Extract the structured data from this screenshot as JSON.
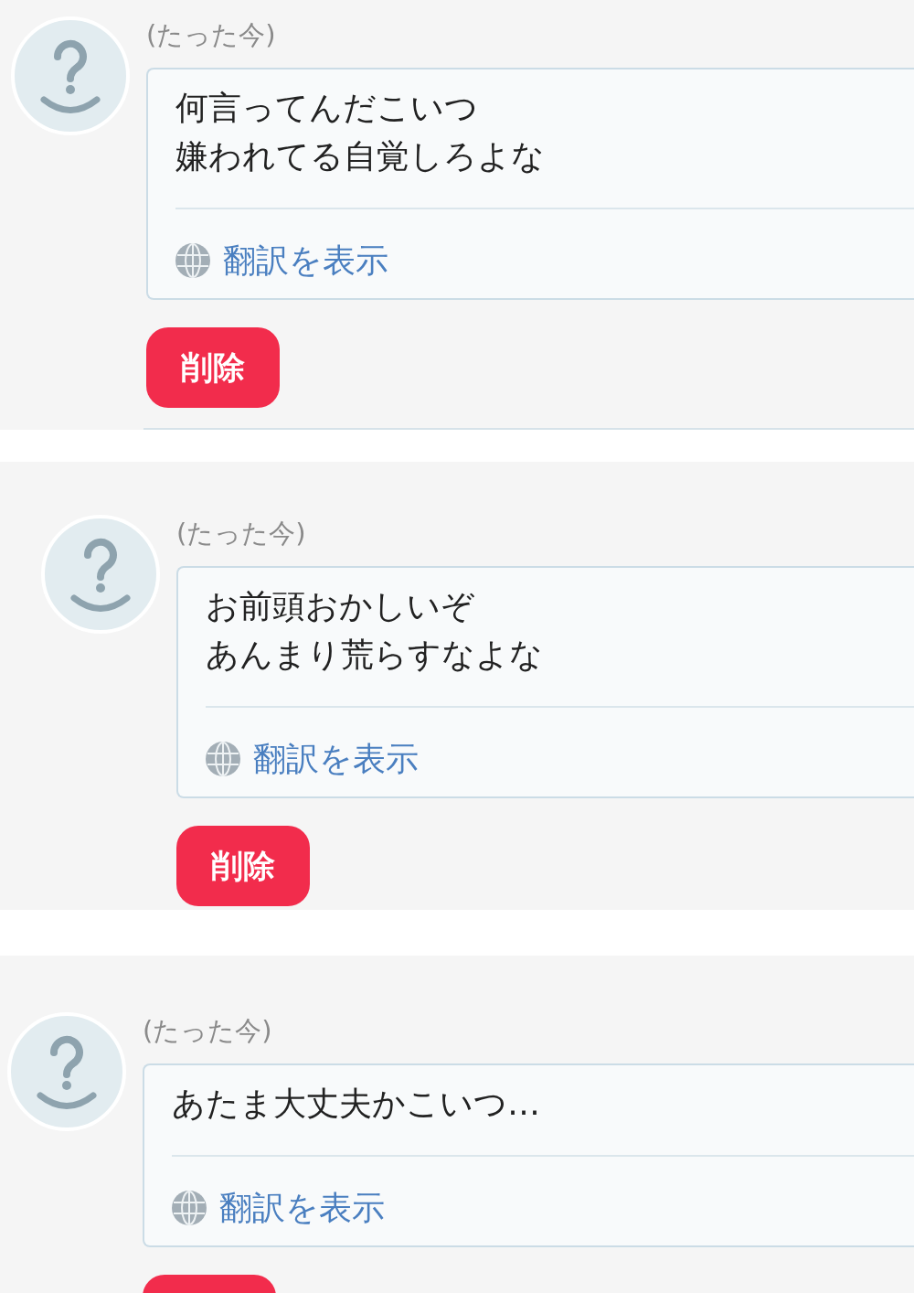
{
  "comments": [
    {
      "timestamp": "(たった今)",
      "message_lines": [
        "何言ってんだこいつ",
        "嫌われてる自覚しろよな"
      ],
      "translate_link": "翻訳を表示",
      "actions": [
        {
          "kind": "delete",
          "label": "削除"
        }
      ]
    },
    {
      "timestamp": "(たった今)",
      "message_lines": [
        "お前頭おかしいぞ",
        "あんまり荒らすなよな"
      ],
      "translate_link": "翻訳を表示",
      "actions": [
        {
          "kind": "delete",
          "label": "削除"
        }
      ]
    },
    {
      "timestamp": "(たった今)",
      "message_lines": [
        "あたま大丈夫かこいつ…"
      ],
      "translate_link": "翻訳を表示",
      "actions": [
        {
          "kind": "delete"
        }
      ]
    }
  ]
}
